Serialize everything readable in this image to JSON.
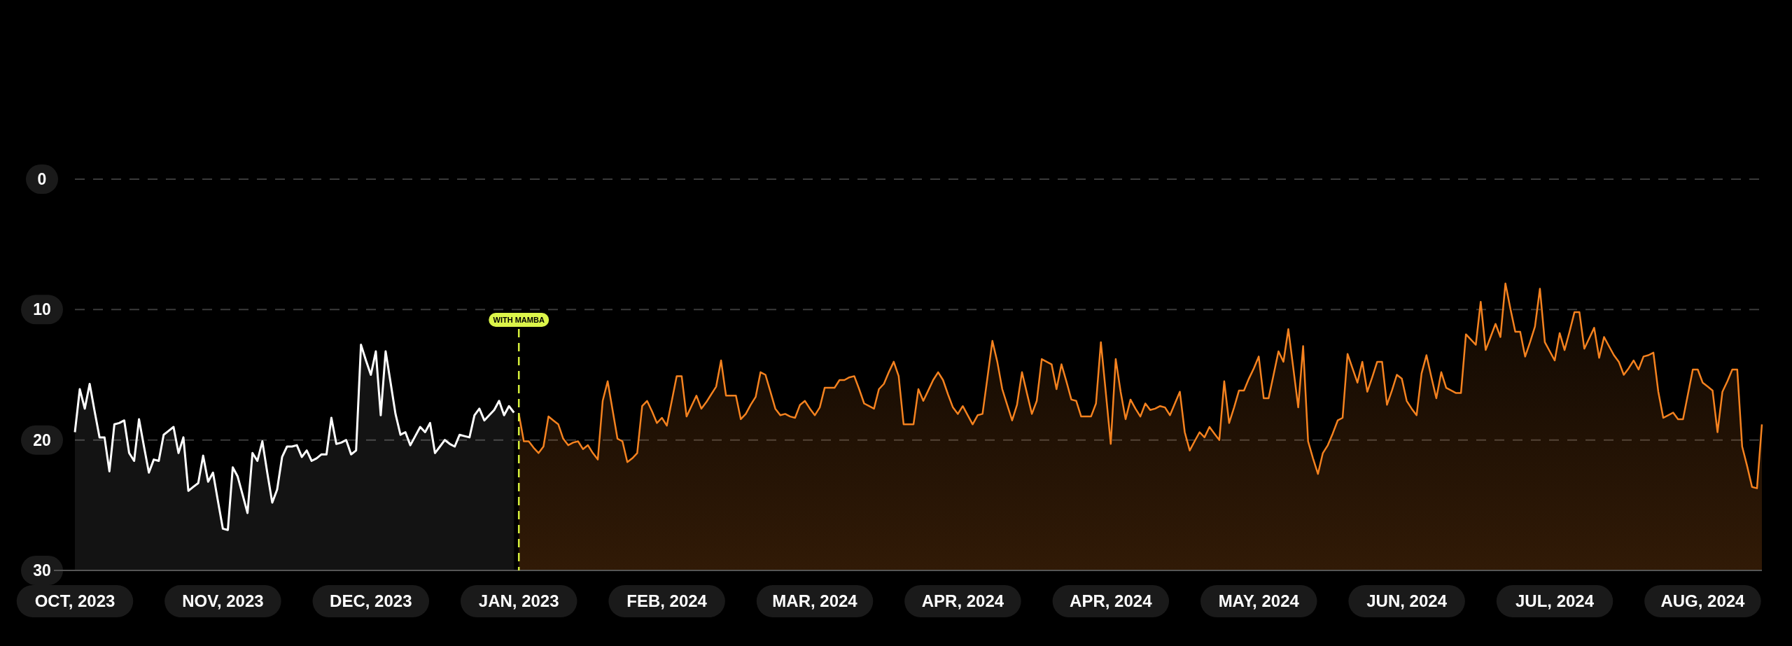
{
  "chart": {
    "chart_data": {
      "type": "line",
      "ylim": [
        30,
        0
      ],
      "yticks": [
        0,
        10,
        20,
        30
      ],
      "categories": [
        "OCT, 2023",
        null,
        null,
        null,
        null,
        null,
        null,
        null,
        null,
        null,
        null,
        null,
        null,
        null,
        null,
        null,
        null,
        null,
        null,
        null,
        null,
        null,
        null,
        null,
        null,
        null,
        null,
        null,
        null,
        null,
        "NOV, 2023",
        null,
        null,
        null,
        null,
        null,
        null,
        null,
        null,
        null,
        null,
        null,
        null,
        null,
        null,
        null,
        null,
        null,
        null,
        null,
        null,
        null,
        null,
        null,
        null,
        null,
        null,
        null,
        null,
        null,
        "DEC, 2023",
        null,
        null,
        null,
        null,
        null,
        null,
        null,
        null,
        null,
        null,
        null,
        null,
        null,
        null,
        null,
        null,
        null,
        null,
        null,
        null,
        null,
        null,
        null,
        null,
        null,
        null,
        null,
        null,
        null,
        "JAN, 2023",
        null,
        null,
        null,
        null,
        null,
        null,
        null,
        null,
        null,
        null,
        null,
        null,
        null,
        null,
        null,
        null,
        null,
        null,
        null,
        null,
        null,
        null,
        null,
        null,
        null,
        null,
        null,
        null,
        null,
        "FEB, 2024",
        null,
        null,
        null,
        null,
        null,
        null,
        null,
        null,
        null,
        null,
        null,
        null,
        null,
        null,
        null,
        null,
        null,
        null,
        null,
        null,
        null,
        null,
        null,
        null,
        null,
        null,
        null,
        null,
        null,
        "MAR, 2024",
        null,
        null,
        null,
        null,
        null,
        null,
        null,
        null,
        null,
        null,
        null,
        null,
        null,
        null,
        null,
        null,
        null,
        null,
        null,
        null,
        null,
        null,
        null,
        null,
        null,
        null,
        null,
        null,
        null,
        "APR, 2024",
        null,
        null,
        null,
        null,
        null,
        null,
        null,
        null,
        null,
        null,
        null,
        null,
        null,
        null,
        null,
        null,
        null,
        null,
        null,
        null,
        null,
        null,
        null,
        null,
        null,
        null,
        null,
        null,
        null,
        "APR, 2024",
        null,
        null,
        null,
        null,
        null,
        null,
        null,
        null,
        null,
        null,
        null,
        null,
        null,
        null,
        null,
        null,
        null,
        null,
        null,
        null,
        null,
        null,
        null,
        null,
        null,
        null,
        null,
        null,
        null,
        "MAY, 2024",
        null,
        null,
        null,
        null,
        null,
        null,
        null,
        null,
        null,
        null,
        null,
        null,
        null,
        null,
        null,
        null,
        null,
        null,
        null,
        null,
        null,
        null,
        null,
        null,
        null,
        null,
        null,
        null,
        null,
        "JUN, 2024",
        null,
        null,
        null,
        null,
        null,
        null,
        null,
        null,
        null,
        null,
        null,
        null,
        null,
        null,
        null,
        null,
        null,
        null,
        null,
        null,
        null,
        null,
        null,
        null,
        null,
        null,
        null,
        null,
        null,
        "JUL, 2024",
        null,
        null,
        null,
        null,
        null,
        null,
        null,
        null,
        null,
        null,
        null,
        null,
        null,
        null,
        null,
        null,
        null,
        null,
        null,
        null,
        null,
        null,
        null,
        null,
        null,
        null,
        null,
        null,
        null,
        "AUG, 2024",
        null,
        null,
        null,
        null,
        null,
        null,
        null,
        null,
        null,
        null,
        null,
        null
      ],
      "annotations": [
        {
          "x": "JAN, 2023",
          "text": "WITH MAMBA"
        }
      ],
      "series": [
        {
          "color": "#ffffff",
          "values": [
            19.4,
            16.1,
            17.6,
            15.7,
            17.8,
            19.8,
            19.8,
            22.4,
            18.8,
            18.7,
            18.5,
            21,
            21.6,
            18.4,
            20.5,
            22.5,
            21.5,
            21.6,
            19.6,
            19.3,
            19,
            21,
            19.8,
            23.9,
            23.6,
            23.3,
            21.2,
            23.2,
            22.5,
            24.7,
            26.8,
            26.9,
            22.1,
            22.8,
            24.2,
            25.6,
            21,
            21.6,
            20.1,
            22.5,
            24.8,
            23.8,
            21.3,
            20.5,
            20.5,
            20.4,
            21.3,
            20.8,
            21.6,
            21.4,
            21.1,
            21.1,
            18.3,
            20.3,
            20.2,
            20,
            21.1,
            20.8,
            12.7,
            13.9,
            15,
            13.2,
            18.1,
            13.2,
            15.6,
            18,
            19.6,
            19.4,
            20.4,
            19.7,
            19,
            19.4,
            18.7,
            21,
            20.5,
            20,
            20.3,
            20.5,
            19.6,
            19.7,
            19.8,
            18.1,
            17.6,
            18.5,
            18.1,
            17.7,
            17,
            18.1,
            17.4,
            17.9,
            null,
            null,
            null,
            null,
            null,
            null,
            null,
            null,
            null,
            null,
            null,
            null,
            null,
            null,
            null,
            null,
            null,
            null,
            null,
            null,
            null,
            null,
            null,
            null,
            null,
            null,
            null,
            null,
            null,
            null,
            null,
            null,
            null,
            null,
            null,
            null,
            null,
            null,
            null,
            null,
            null,
            null,
            null,
            null,
            null,
            null,
            null,
            null,
            null,
            null,
            null,
            null,
            null,
            null,
            null,
            null,
            null,
            null,
            null,
            null,
            null,
            null,
            null,
            null,
            null,
            null,
            null,
            null,
            null,
            null,
            null,
            null,
            null,
            null,
            null,
            null,
            null,
            null,
            null,
            null,
            null,
            null,
            null,
            null,
            null,
            null,
            null,
            null,
            null,
            null,
            null,
            null,
            null,
            null,
            null,
            null,
            null,
            null,
            null,
            null,
            null,
            null,
            null,
            null,
            null,
            null,
            null,
            null,
            null,
            null,
            null,
            null,
            null,
            null,
            null,
            null,
            null,
            null,
            null,
            null,
            null,
            null,
            null,
            null,
            null,
            null,
            null,
            null,
            null,
            null,
            null,
            null,
            null,
            null,
            null,
            null,
            null,
            null,
            null,
            null,
            null,
            null,
            null,
            null,
            null,
            null,
            null,
            null,
            null,
            null,
            null,
            null,
            null,
            null,
            null,
            null,
            null,
            null,
            null,
            null,
            null,
            null,
            null,
            null,
            null,
            null,
            null,
            null,
            null,
            null,
            null,
            null,
            null,
            null,
            null,
            null,
            null,
            null,
            null,
            null,
            null,
            null,
            null,
            null,
            null,
            null,
            null,
            null,
            null,
            null,
            null,
            null,
            null,
            null,
            null,
            null,
            null,
            null,
            null,
            null,
            null,
            null,
            null,
            null,
            null,
            null,
            null,
            null,
            null,
            null,
            null,
            null,
            null,
            null,
            null,
            null,
            null,
            null,
            null,
            null,
            null,
            null,
            null,
            null,
            null,
            null,
            null,
            null,
            null,
            null,
            null,
            null,
            null,
            null,
            null,
            null,
            null,
            null,
            null,
            null,
            null,
            null,
            null,
            null,
            null,
            null,
            null,
            null,
            null,
            null,
            null,
            null,
            null
          ]
        },
        {
          "color": "#f5821f",
          "values": [
            null,
            null,
            null,
            null,
            null,
            null,
            null,
            null,
            null,
            null,
            null,
            null,
            null,
            null,
            null,
            null,
            null,
            null,
            null,
            null,
            null,
            null,
            null,
            null,
            null,
            null,
            null,
            null,
            null,
            null,
            null,
            null,
            null,
            null,
            null,
            null,
            null,
            null,
            null,
            null,
            null,
            null,
            null,
            null,
            null,
            null,
            null,
            null,
            null,
            null,
            null,
            null,
            null,
            null,
            null,
            null,
            null,
            null,
            null,
            null,
            null,
            null,
            null,
            null,
            null,
            null,
            null,
            null,
            null,
            null,
            null,
            null,
            null,
            null,
            null,
            null,
            null,
            null,
            null,
            null,
            null,
            null,
            null,
            null,
            null,
            null,
            null,
            null,
            null,
            null,
            18,
            20.1,
            20.1,
            20.6,
            21,
            20.5,
            18.2,
            18.5,
            18.8,
            19.9,
            20.4,
            20.2,
            20.1,
            20.7,
            20.4,
            21,
            21.5,
            17,
            15.5,
            17.7,
            19.9,
            20.1,
            21.7,
            21.4,
            21,
            17.4,
            17,
            17.8,
            18.7,
            18.3,
            18.9,
            17,
            15.1,
            15.1,
            18.2,
            17.4,
            16.6,
            17.6,
            17.1,
            16.5,
            15.9,
            13.9,
            16.6,
            16.6,
            16.6,
            18.4,
            18,
            17.3,
            16.7,
            14.8,
            15,
            16.3,
            17.6,
            18.1,
            18,
            18.2,
            18.3,
            17.3,
            17,
            17.6,
            18.1,
            17.5,
            16,
            16,
            16,
            15.4,
            15.4,
            15.2,
            15.1,
            16.1,
            17.2,
            17.4,
            17.6,
            16.1,
            15.7,
            14.8,
            14,
            15.1,
            18.8,
            18.8,
            18.8,
            16.1,
            17,
            16.2,
            15.4,
            14.8,
            15.4,
            16.5,
            17.5,
            18,
            17.4,
            18.1,
            18.8,
            18.1,
            18,
            15.2,
            12.4,
            14,
            16.1,
            17.3,
            18.5,
            17.3,
            14.8,
            16.4,
            18,
            17,
            13.8,
            14,
            14.2,
            16.1,
            14.2,
            15.5,
            16.9,
            17,
            18.2,
            18.2,
            18.2,
            17.2,
            12.5,
            16.4,
            20.3,
            13.8,
            16.3,
            18.4,
            16.9,
            17.6,
            18.2,
            17.2,
            17.7,
            17.6,
            17.4,
            17.5,
            18.1,
            17.2,
            16.3,
            19.4,
            20.8,
            20.1,
            19.4,
            19.8,
            19,
            19.5,
            20,
            15.5,
            18.7,
            17.5,
            16.2,
            16.2,
            15.3,
            14.5,
            13.6,
            16.8,
            16.8,
            15,
            13.2,
            14,
            11.5,
            14.5,
            17.5,
            12.8,
            20.1,
            21.4,
            22.6,
            21,
            20.4,
            19.5,
            18.5,
            18.3,
            13.4,
            14.5,
            15.6,
            14,
            16.3,
            15.2,
            14,
            14,
            17.3,
            16.2,
            15,
            15.3,
            17,
            17.6,
            18.1,
            14.9,
            13.5,
            15.2,
            16.8,
            14.8,
            16,
            16.2,
            16.4,
            16.4,
            11.9,
            12.3,
            12.7,
            9.4,
            13.1,
            12.1,
            11.1,
            12.1,
            8,
            9.9,
            11.7,
            11.7,
            13.6,
            12.5,
            11.3,
            8.4,
            12.5,
            13.2,
            13.9,
            11.8,
            13.1,
            11.7,
            10.2,
            10.2,
            13,
            12.2,
            11.4,
            13.7,
            12.1,
            12.8,
            13.5,
            14,
            15,
            14.5,
            13.9,
            14.6,
            13.6,
            13.5,
            13.3,
            16.3,
            18.3,
            18.1,
            17.9,
            18.4,
            18.4,
            16.5,
            14.6,
            14.6,
            15.6,
            15.9,
            16.2,
            19.4,
            16.3,
            15.5,
            14.6,
            14.6,
            20.5,
            22,
            23.6,
            23.7,
            18.8
          ]
        }
      ]
    }
  }
}
